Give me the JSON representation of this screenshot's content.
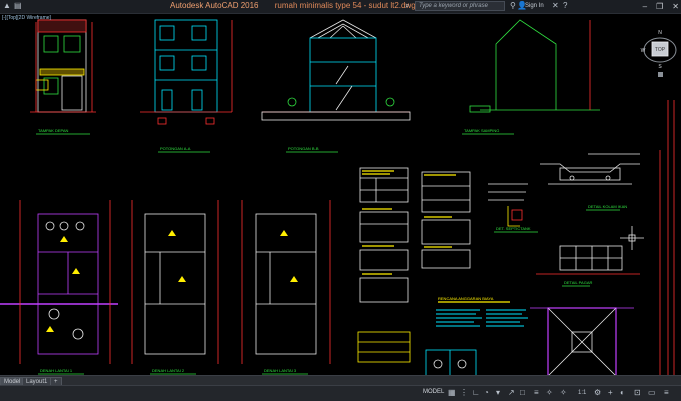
{
  "window": {
    "app_name": "Autodesk AutoCAD 2016",
    "file_name": "rumah minimalis type 54 - sudut lt2.dwg",
    "search_placeholder": "Type a keyword or phrase",
    "sign_in_label": "Sign In",
    "controls": [
      "–",
      "❐",
      "✕"
    ]
  },
  "viewport": {
    "label": "[-][Top][2D Wireframe]"
  },
  "viewcube": {
    "top_label": "TOP",
    "north": "N",
    "south": "S",
    "east": "E",
    "west": "W"
  },
  "drawing": {
    "background": "#000000",
    "elevation_titles": [
      "TAMPAK DEPAN",
      "POTONGAN A-A",
      "POTONGAN B-B",
      "TAMPAK SAMPING"
    ],
    "plan_titles": [
      "DENAH LANTAI 1",
      "DENAH LANTAI 2",
      "DENAH LANTAI 3"
    ],
    "detail_titles": [
      "DET. SEPTICTANK",
      "DENAH RENCANA",
      "DETAIL PAGAR",
      "DETAIL KOLAM IKAN"
    ],
    "note_title": "RENCANA ANGGARAN BIAYA"
  },
  "tabs": [
    "Model",
    "Layout1",
    "+"
  ],
  "statusbar": {
    "model_label": "MODEL",
    "scale": "1:1"
  },
  "colors": {
    "cyan": "#00e5ff",
    "yellow": "#ffee00",
    "magenta": "#c040ff",
    "green": "#30e040",
    "red": "#ff3030",
    "white": "#e8e8e8"
  }
}
